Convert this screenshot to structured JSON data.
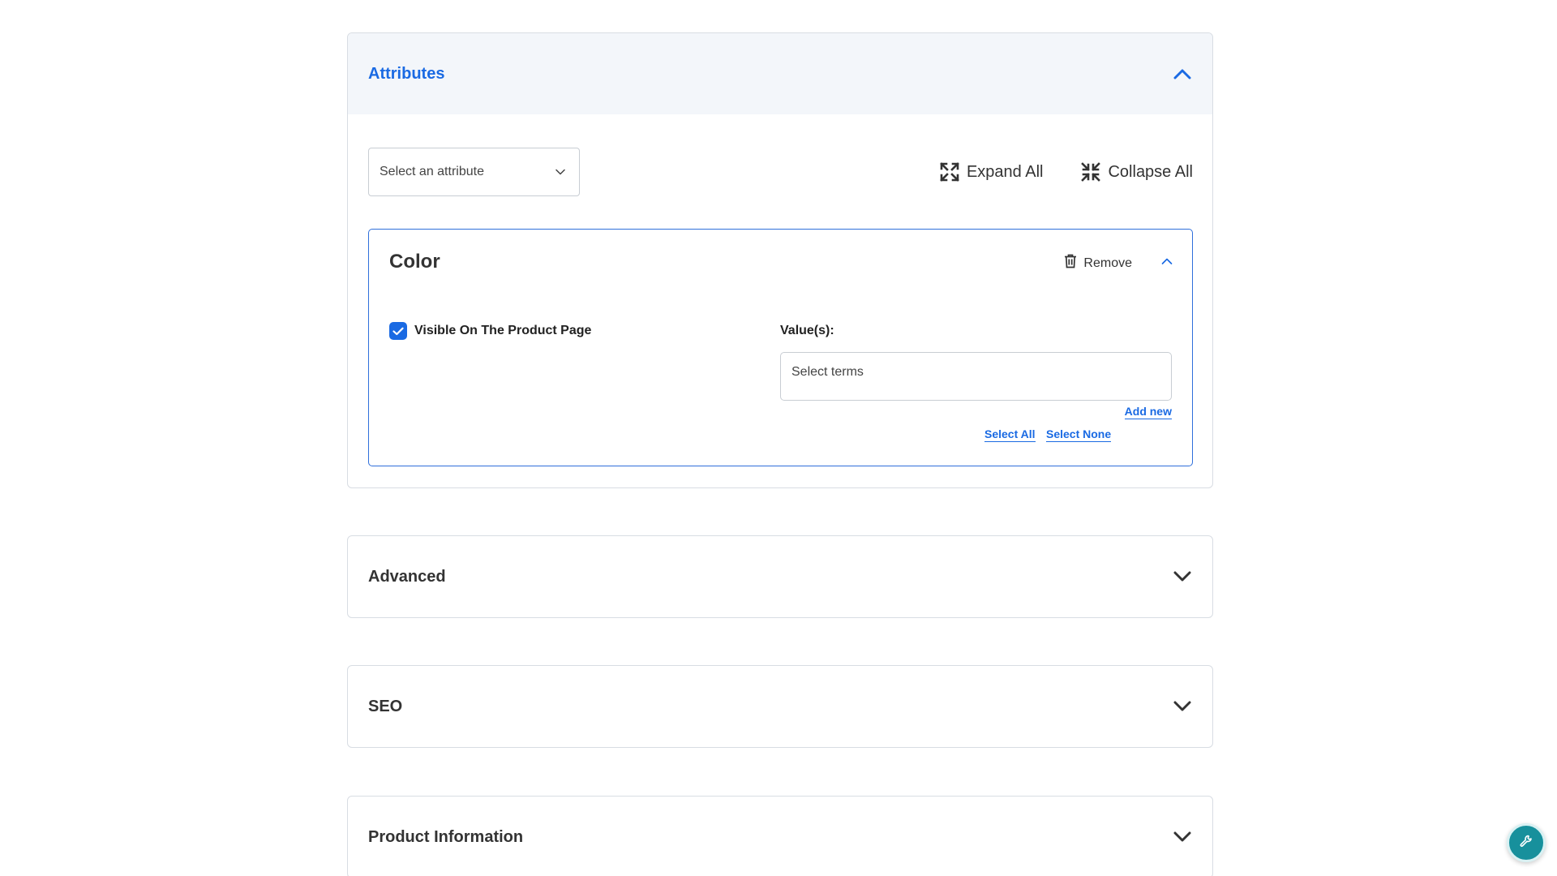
{
  "attributes_panel": {
    "title": "Attributes",
    "select_placeholder": "Select an attribute",
    "expand_all": "Expand All",
    "collapse_all": "Collapse All",
    "attribute": {
      "name": "Color",
      "remove_label": "Remove",
      "visible_label": "Visible On The Product Page",
      "visible_checked": true,
      "values_label": "Value(s):",
      "terms_placeholder": "Select terms",
      "add_new": "Add new",
      "select_all": "Select All",
      "select_none": "Select None"
    }
  },
  "sections": [
    {
      "title": "Advanced"
    },
    {
      "title": "SEO"
    },
    {
      "title": "Product Information"
    }
  ],
  "icons": {
    "expand": "expand-arrows-icon",
    "collapse": "collapse-arrows-icon",
    "trash": "trash-icon",
    "chevron_up": "chevron-up-icon",
    "chevron_down": "chevron-down-icon",
    "wrench": "wrench-icon"
  },
  "colors": {
    "accent": "#1a6ae3",
    "fab": "#17909c"
  }
}
